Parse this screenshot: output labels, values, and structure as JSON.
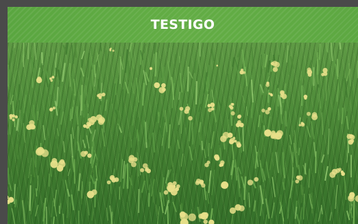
{
  "header": {
    "title": "TESTIGO"
  },
  "photo": {
    "subject": "green-grass-field-with-yellow-flowers",
    "colors": {
      "grass": "#4f8c3a",
      "flower": "#e8e08a"
    }
  },
  "colors": {
    "header_bg": "#5da842",
    "frame_bg": "#4a4a4a",
    "title_text": "#ffffff"
  }
}
